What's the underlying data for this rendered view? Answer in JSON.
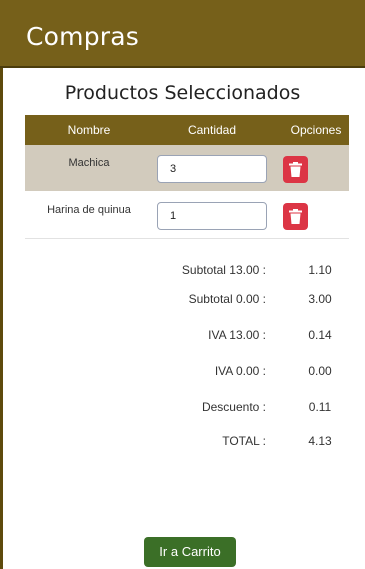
{
  "header": {
    "title": "Compras"
  },
  "section": {
    "title": "Productos Seleccionados"
  },
  "table": {
    "headers": [
      "Nombre",
      "Cantidad",
      "Opciones"
    ],
    "rows": [
      {
        "name": "Machica",
        "quantity": "3"
      },
      {
        "name": "Harina de quinua",
        "quantity": "1"
      }
    ]
  },
  "summary": [
    {
      "label": "Subtotal 13.00 :",
      "value": "1.10"
    },
    {
      "label": "Subtotal 0.00 :",
      "value": "3.00"
    },
    {
      "label": "IVA 13.00 :",
      "value": "0.14"
    },
    {
      "label": "IVA 0.00 :",
      "value": "0.00"
    },
    {
      "label": "Descuento :",
      "value": "0.11"
    },
    {
      "label": "TOTAL :",
      "value": "4.13"
    }
  ],
  "footer": {
    "cart_button": "Ir a Carrito"
  },
  "colors": {
    "header": "#76601a",
    "delete": "#dc3545",
    "cart_button": "#3b6f27",
    "selected_row": "#d2cbbd"
  },
  "icons": {
    "delete": "trash-icon"
  }
}
